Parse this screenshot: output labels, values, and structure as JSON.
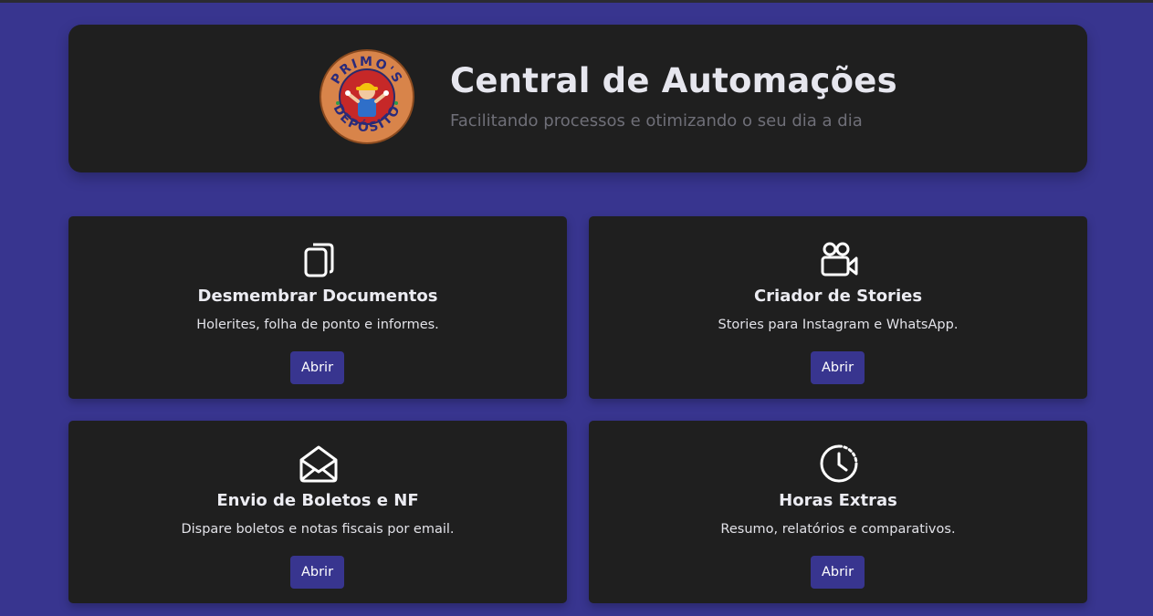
{
  "header": {
    "title": "Central de Automações",
    "subtitle": "Facilitando processos e otimizando o seu dia a dia",
    "logo": {
      "top_text": "PRIMO'S",
      "bottom_text": "DEPÓSITO"
    }
  },
  "colors": {
    "background": "#38358f",
    "card": "#1f1f1f",
    "button": "#38358f",
    "logo_ring": "#d8844a",
    "logo_inner": "#c62828"
  },
  "cards": [
    {
      "icon": "documents-icon",
      "title": "Desmembrar Documentos",
      "description": "Holerites, folha de ponto e informes.",
      "button_label": "Abrir"
    },
    {
      "icon": "video-camera-icon",
      "title": "Criador de Stories",
      "description": "Stories para Instagram e WhatsApp.",
      "button_label": "Abrir"
    },
    {
      "icon": "envelope-open-icon",
      "title": "Envio de Boletos e NF",
      "description": "Dispare boletos e notas fiscais por email.",
      "button_label": "Abrir"
    },
    {
      "icon": "clock-history-icon",
      "title": "Horas Extras",
      "description": "Resumo, relatórios e comparativos.",
      "button_label": "Abrir"
    }
  ]
}
